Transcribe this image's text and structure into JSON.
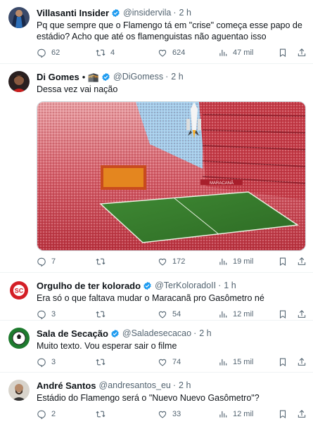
{
  "tweets": [
    {
      "name": "Villasanti Insider",
      "handle": "@insidervila",
      "time": "2 h",
      "text": "Pq que sempre que o Flamengo tá em \"crise\" começa esse papo de estádio? Acho que até os flamenguistas não aguentao isso",
      "replies": "62",
      "retweets": "4",
      "likes": "624",
      "views": "47 mil"
    },
    {
      "name": "Di Gomes",
      "name_suffix": "• 🕋",
      "handle": "@DiGomess",
      "time": "2 h",
      "text": "Dessa vez vai nação",
      "media_caption": "MARACANÃ",
      "replies": "7",
      "retweets": "",
      "likes": "172",
      "views": "19 mil"
    },
    {
      "name": "Orgulho de ter kolorado",
      "handle": "@TerKoloradoII",
      "time": "1 h",
      "text": "Era só o que faltava mudar o Maracanã pro Gasômetro né",
      "replies": "3",
      "retweets": "",
      "likes": "54",
      "views": "12 mil"
    },
    {
      "name": "Sala de Secação",
      "handle": "@Saladesecacao",
      "time": "2 h",
      "text": "Muito texto. Vou esperar sair o filme",
      "replies": "3",
      "retweets": "",
      "likes": "74",
      "views": "15 mil"
    },
    {
      "name": "André Santos",
      "handle": "@andresantos_eu",
      "time": "2 h",
      "text": "Estádio do Flamengo será o \"Nuevo Nuevo Gasômetro\"?",
      "replies": "2",
      "retweets": "",
      "likes": "33",
      "views": "12 mil"
    }
  ],
  "colors": {
    "text": "#0f1419",
    "secondary": "#536471",
    "verified": "#1d9bf0",
    "divider": "#eff3f4"
  },
  "icons": [
    "reply-icon",
    "retweet-icon",
    "like-icon",
    "views-icon",
    "bookmark-icon",
    "share-icon",
    "verified-badge-icon"
  ]
}
